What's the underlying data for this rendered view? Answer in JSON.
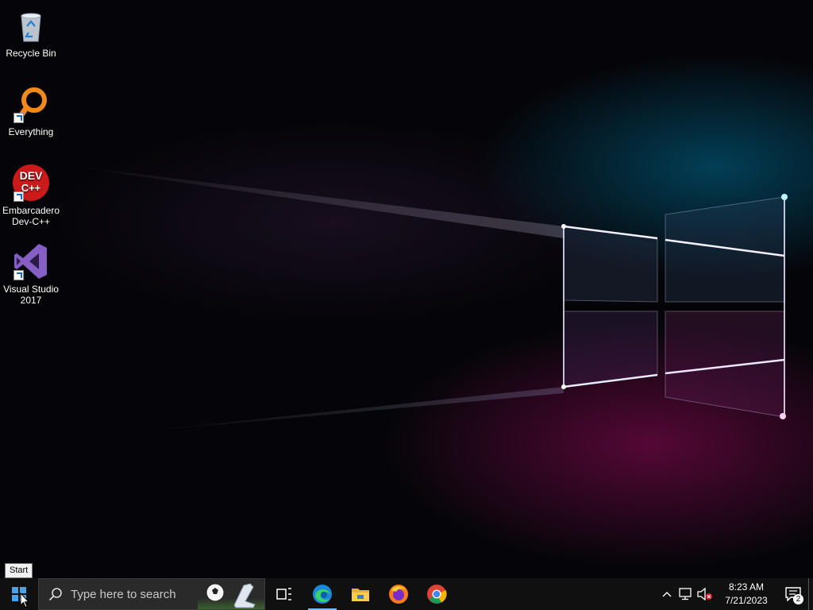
{
  "desktop": {
    "icons": [
      {
        "label": "Recycle Bin",
        "icon": "recycle-bin-icon"
      },
      {
        "label": "Everything",
        "icon": "everything-search-icon"
      },
      {
        "label": "Embarcadero Dev-C++",
        "icon": "dev-cpp-icon",
        "logo_text": "DEV C++"
      },
      {
        "label": "Visual Studio 2017",
        "icon": "visual-studio-icon"
      }
    ]
  },
  "tooltip": {
    "text": "Start"
  },
  "taskbar": {
    "search_placeholder": "Type here to search",
    "pinned": [
      {
        "name": "task-view",
        "icon": "task-view-icon"
      },
      {
        "name": "edge",
        "icon": "edge-icon",
        "active": true
      },
      {
        "name": "file-explorer",
        "icon": "folder-icon"
      },
      {
        "name": "firefox",
        "icon": "firefox-icon"
      },
      {
        "name": "chrome",
        "icon": "chrome-icon"
      }
    ],
    "clock": {
      "time": "8:23 AM",
      "date": "7/21/2023"
    },
    "notification_count": "2"
  },
  "colors": {
    "taskbar": "#101010",
    "accent": "#76b9ed",
    "wallpaper_cyan": "#19c0e8",
    "wallpaper_magenta": "#e0168f"
  }
}
